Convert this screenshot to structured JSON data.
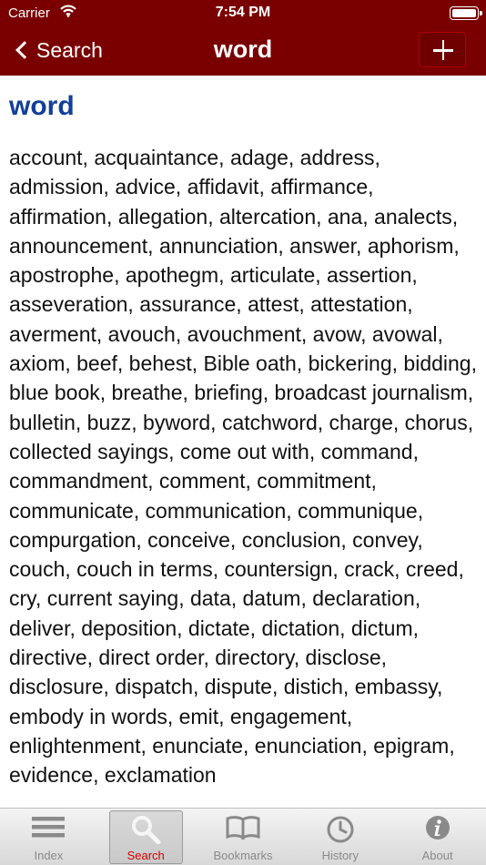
{
  "status_bar": {
    "carrier": "Carrier",
    "time": "7:54 PM"
  },
  "nav": {
    "back_label": "Search",
    "title": "word"
  },
  "entry": {
    "headword": "word",
    "synonyms": "account, acquaintance, adage, address, admission, advice, affidavit, affirmance, affirmation, allegation, altercation, ana, analects, announcement, annunciation, answer, aphorism, apostrophe, apothegm, articulate, assertion, asseveration, assurance, attest, attestation, averment, avouch, avouchment, avow, avowal, axiom, beef, behest, Bible oath, bickering, bidding, blue book, breathe, briefing, broadcast journalism, bulletin, buzz, byword, catchword, charge, chorus, collected sayings, come out with, command, commandment, comment, commitment, communicate, communication, communique, compurgation, conceive, conclusion, convey, couch, couch in terms, countersign, crack, creed, cry, current saying, data, datum, declaration, deliver, deposition, dictate, dictation, dictum, directive, direct order, directory, disclose, disclosure, dispatch, dispute, distich, embassy, embody in words, emit, engagement, enlightenment, enunciate, enunciation, epigram, evidence, exclamation"
  },
  "tabs": [
    {
      "label": "Index",
      "icon": "list-icon",
      "active": false
    },
    {
      "label": "Search",
      "icon": "magnifier-icon",
      "active": true
    },
    {
      "label": "Bookmarks",
      "icon": "book-icon",
      "active": false
    },
    {
      "label": "History",
      "icon": "clock-icon",
      "active": false
    },
    {
      "label": "About",
      "icon": "info-icon",
      "active": false
    }
  ],
  "colors": {
    "brand": "#7a0000",
    "headword": "#123f98",
    "active_tab": "#d40000"
  }
}
